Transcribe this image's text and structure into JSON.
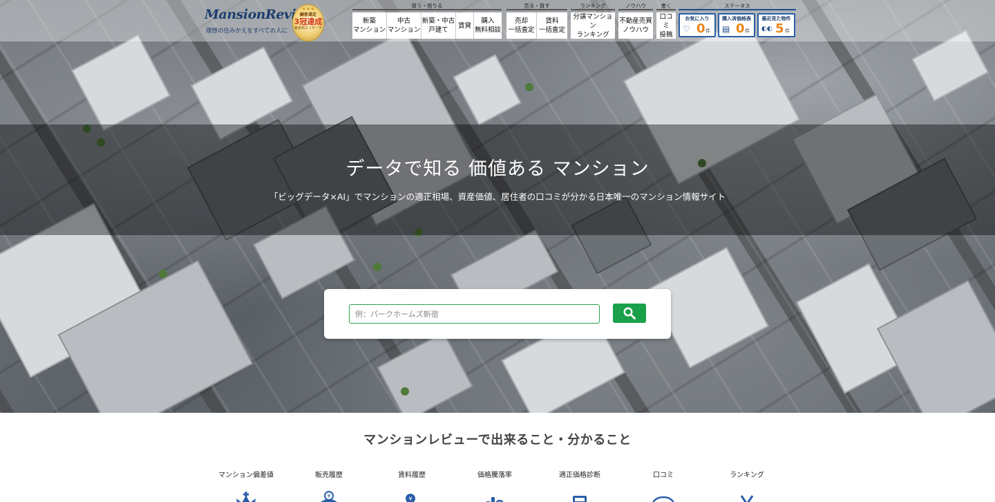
{
  "header": {
    "logo": "MansionReview",
    "tagline": "理想の住みかえをすべての人に",
    "award": {
      "l1": "顧客満足",
      "l2": "3冠達成",
      "l3": "東京商工リサーチ"
    },
    "groups": [
      {
        "title": "買う・借りる",
        "items": [
          "新築\nマンション",
          "中古\nマンション",
          "新築・中古\n戸建て",
          "賃貸",
          "購入\n無料相談"
        ]
      },
      {
        "title": "売る・貸す",
        "items": [
          "売却\n一括査定",
          "賃料\n一括査定"
        ]
      },
      {
        "title": "ランキング",
        "items": [
          "分譲マンション\nランキング"
        ]
      },
      {
        "title": "ノウハウ",
        "items": [
          "不動産売買\nノウハウ"
        ]
      },
      {
        "title": "書く",
        "items": [
          "口コミ\n投稿"
        ]
      }
    ],
    "status": {
      "title": "ステータス",
      "items": [
        {
          "label": "お気に入り",
          "icon": "heart-icon",
          "glyph": "♡",
          "count": "0",
          "unit": "件"
        },
        {
          "label": "購入済価格表",
          "icon": "document-icon",
          "glyph": "▤",
          "count": "0",
          "unit": "件"
        },
        {
          "label": "最近見た物件",
          "icon": "eyes-icon",
          "glyph": "◐◐",
          "count": "5",
          "unit": "件"
        }
      ]
    }
  },
  "hero": {
    "title": "データで知る 価値ある マンション",
    "subtitle": "「ビッグデータ×AI」でマンションの適正相場、資産価値、居住者の口コミが分かる日本唯一のマンション情報サイト"
  },
  "search": {
    "placeholder": "例：パークホームズ新宿",
    "value": ""
  },
  "features": {
    "title": "マンションレビューで出来ること・分かること",
    "items": [
      {
        "label": "マンション偏差値",
        "icon": "crown-icon"
      },
      {
        "label": "販売履歴",
        "icon": "piggy-bank-icon"
      },
      {
        "label": "賃料履歴",
        "icon": "coins-icon"
      },
      {
        "label": "価格騰落率",
        "icon": "chart-magnifier-icon"
      },
      {
        "label": "適正価格診断",
        "icon": "calculator-icon"
      },
      {
        "label": "口コミ",
        "icon": "speech-bubble-icon"
      },
      {
        "label": "ランキング",
        "icon": "medal-icon"
      }
    ]
  },
  "colors": {
    "brand": "#1d3e6f",
    "accent": "#1aa04a",
    "count": "#e8861a",
    "feature_icon": "#2a5ea8"
  }
}
